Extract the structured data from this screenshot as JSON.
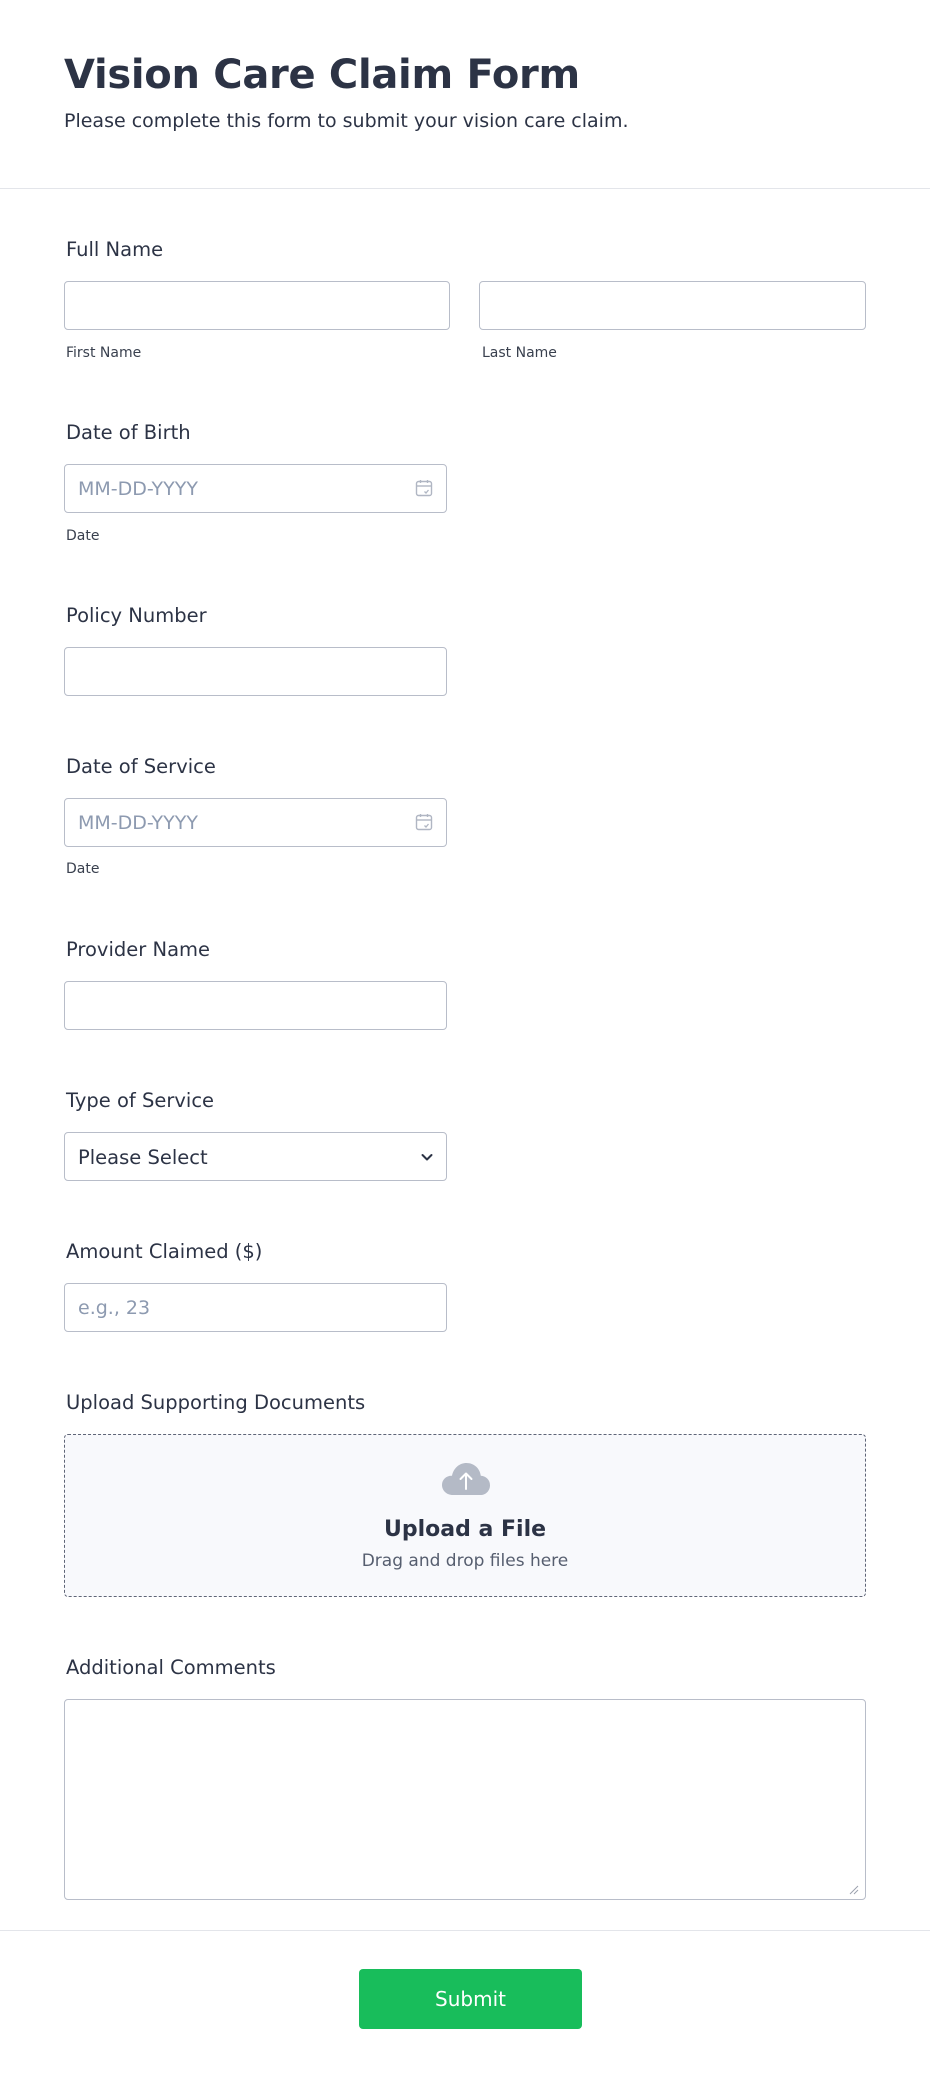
{
  "header": {
    "title": "Vision Care Claim Form",
    "subtitle": "Please complete this form to submit your vision care claim."
  },
  "full_name": {
    "label": "Full Name",
    "first_value": "",
    "last_value": "",
    "first_sublabel": "First Name",
    "last_sublabel": "Last Name"
  },
  "date_of_birth": {
    "label": "Date of Birth",
    "value": "",
    "placeholder": "MM-DD-YYYY",
    "sublabel": "Date",
    "icon": "calendar-icon"
  },
  "policy_number": {
    "label": "Policy Number",
    "value": ""
  },
  "date_of_service": {
    "label": "Date of Service",
    "value": "",
    "placeholder": "MM-DD-YYYY",
    "sublabel": "Date",
    "icon": "calendar-icon"
  },
  "provider_name": {
    "label": "Provider Name",
    "value": ""
  },
  "type_of_service": {
    "label": "Type of Service",
    "selected": "Please Select",
    "icon": "chevron-down-icon"
  },
  "amount_claimed": {
    "label": "Amount Claimed ($)",
    "value": "",
    "placeholder": "e.g., 23"
  },
  "upload": {
    "label": "Upload Supporting Documents",
    "title": "Upload a File",
    "description": "Drag and drop files here",
    "icon": "cloud-upload-icon"
  },
  "comments": {
    "label": "Additional Comments",
    "value": ""
  },
  "footer": {
    "submit_label": "Submit"
  },
  "colors": {
    "text": "#2c3345",
    "border": "#b8bdc9",
    "placeholder": "#8d9ab0",
    "submit": "#18bd5b",
    "upload_bg": "#f8f9fc"
  }
}
